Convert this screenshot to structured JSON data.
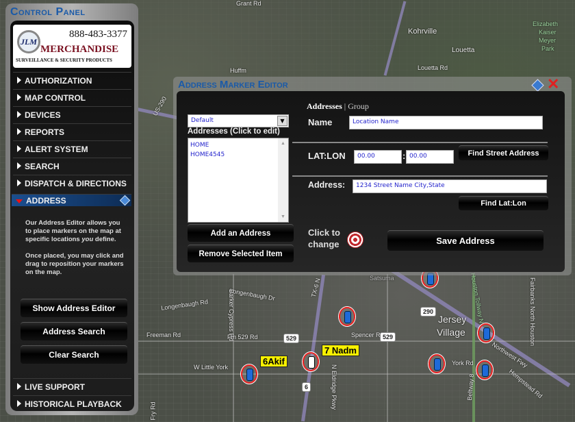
{
  "map": {
    "labels": [
      "Grant Rd",
      "Kohrville",
      "Louetta",
      "Louetta Rd",
      "Elizabeth",
      "Kaiser",
      "Meyer",
      "Park",
      "Huffm",
      "US-290",
      "Satsuma",
      "Jersey",
      "Village",
      "Longenbaugh Rd",
      "Longenbaugh Dr",
      "Barker Cypress Rd",
      "Freeman Rd",
      "Fm 529 Rd",
      "Spencer Rd",
      "W Little York",
      "York Rd",
      "Northwest Fwy",
      "Hempstead Rd",
      "N Eldridge Pkwy",
      "Fairbanks North Houston",
      "TX-6 N",
      "Fry Rd",
      "Beltway 8",
      "Houston Tollway N"
    ],
    "shields": [
      "529",
      "529",
      "290",
      "6"
    ],
    "vehicle_tags": [
      "6Akif",
      "7 Nadm"
    ]
  },
  "control_panel": {
    "title": "Control Panel",
    "logo": {
      "phone": "888-483-3377",
      "initials": "JLM",
      "name": "MERCHANDISE",
      "tagline": "SURVEILLANCE & SECURITY PRODUCTS"
    },
    "menu": [
      "AUTHORIZATION",
      "MAP CONTROL",
      "DEVICES",
      "REPORTS",
      "ALERT SYSTEM",
      "SEARCH",
      "DISPATCH & DIRECTIONS",
      "ADDRESS"
    ],
    "description_1a": "Our Address Editor allows you to place markers on the map at specific locations ",
    "description_1b": "you",
    "description_1c": " define.",
    "description_2": "Once placed, you may click and drag to reposition your markers on the map.",
    "buttons": [
      "Show Address Editor",
      "Address Search",
      "Clear Search"
    ],
    "bottom_menu": [
      "LIVE SUPPORT",
      "HISTORICAL PLAYBACK"
    ]
  },
  "dialog": {
    "title": "Address Marker Editor",
    "close": "✕",
    "group_select": "Default",
    "list_label": "Addresses  (Click to edit)",
    "list_items": [
      "HOME",
      "HOME4545"
    ],
    "add_button": "Add an Address",
    "remove_button": "Remove Selected Item",
    "tab_addresses": "Addresses",
    "tab_sep": "|",
    "tab_group": "Group",
    "name_label": "Name",
    "name_value": "Location Name",
    "latlon_label": "LAT:LON",
    "lat_value": "00.00",
    "lon_value": "00.00",
    "latlon_sep": ":",
    "find_street_button": "Find Street Address",
    "address_label": "Address:",
    "address_value": "1234 Street Name City,State",
    "find_latlon_button": "Find Lat:Lon",
    "click_to_change": "Click to change",
    "save_button": "Save Address"
  }
}
